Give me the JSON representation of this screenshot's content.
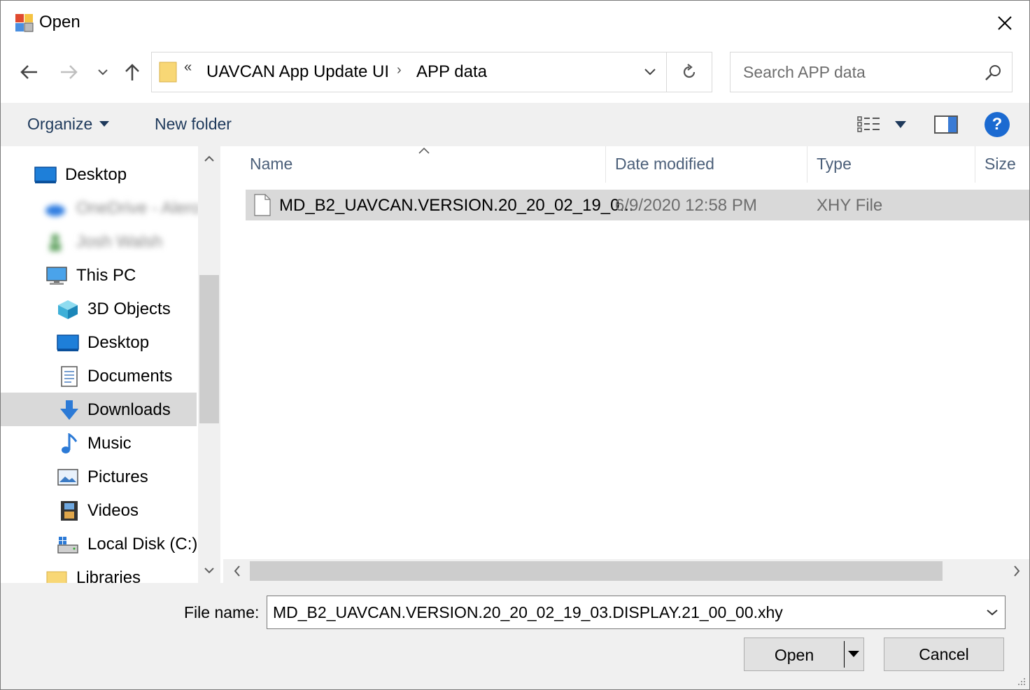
{
  "window": {
    "title": "Open",
    "close_label": "✕"
  },
  "nav": {
    "back_icon": "arrow-left",
    "forward_icon": "arrow-right",
    "recent_icon": "chevron-down",
    "up_icon": "arrow-up"
  },
  "address": {
    "overflow": "«",
    "crumbs": [
      "UAVCAN App Update UI",
      "APP data"
    ],
    "separator": "›"
  },
  "search": {
    "placeholder": "Search APP data"
  },
  "toolbar": {
    "organize_label": "Organize",
    "new_folder_label": "New folder",
    "help_label": "?"
  },
  "sidebar": {
    "items": [
      {
        "label": "Desktop",
        "icon": "desktop-icon"
      },
      {
        "label": "OneDrive - Alero",
        "icon": "onedrive-icon",
        "blurred": true
      },
      {
        "label": "Josh Walsh",
        "icon": "user-icon",
        "blurred": true
      },
      {
        "label": "This PC",
        "icon": "pc-icon"
      },
      {
        "label": "3D Objects",
        "icon": "cube-icon"
      },
      {
        "label": "Desktop",
        "icon": "desktop-icon"
      },
      {
        "label": "Documents",
        "icon": "documents-icon"
      },
      {
        "label": "Downloads",
        "icon": "download-icon",
        "selected": true
      },
      {
        "label": "Music",
        "icon": "music-icon"
      },
      {
        "label": "Pictures",
        "icon": "pictures-icon"
      },
      {
        "label": "Videos",
        "icon": "videos-icon"
      },
      {
        "label": "Local Disk (C:)",
        "icon": "disk-icon"
      },
      {
        "label": "Libraries",
        "icon": "libraries-icon"
      }
    ]
  },
  "filelist": {
    "columns": [
      "Name",
      "Date modified",
      "Type",
      "Size"
    ],
    "rows": [
      {
        "name": "MD_B2_UAVCAN.VERSION.20_20_02_19_0...",
        "date": "6/9/2020 12:58 PM",
        "type": "XHY File",
        "size": ""
      }
    ]
  },
  "footer": {
    "filename_label": "File name:",
    "filename_value": "MD_B2_UAVCAN.VERSION.20_20_02_19_03.DISPLAY.21_00_00.xhy",
    "open_label": "Open",
    "cancel_label": "Cancel"
  },
  "colors": {
    "accent": "#1b6ad1",
    "selection": "#d9d9d9",
    "toolbar_bg": "#f0f0f0",
    "header_text": "#4c607a"
  }
}
